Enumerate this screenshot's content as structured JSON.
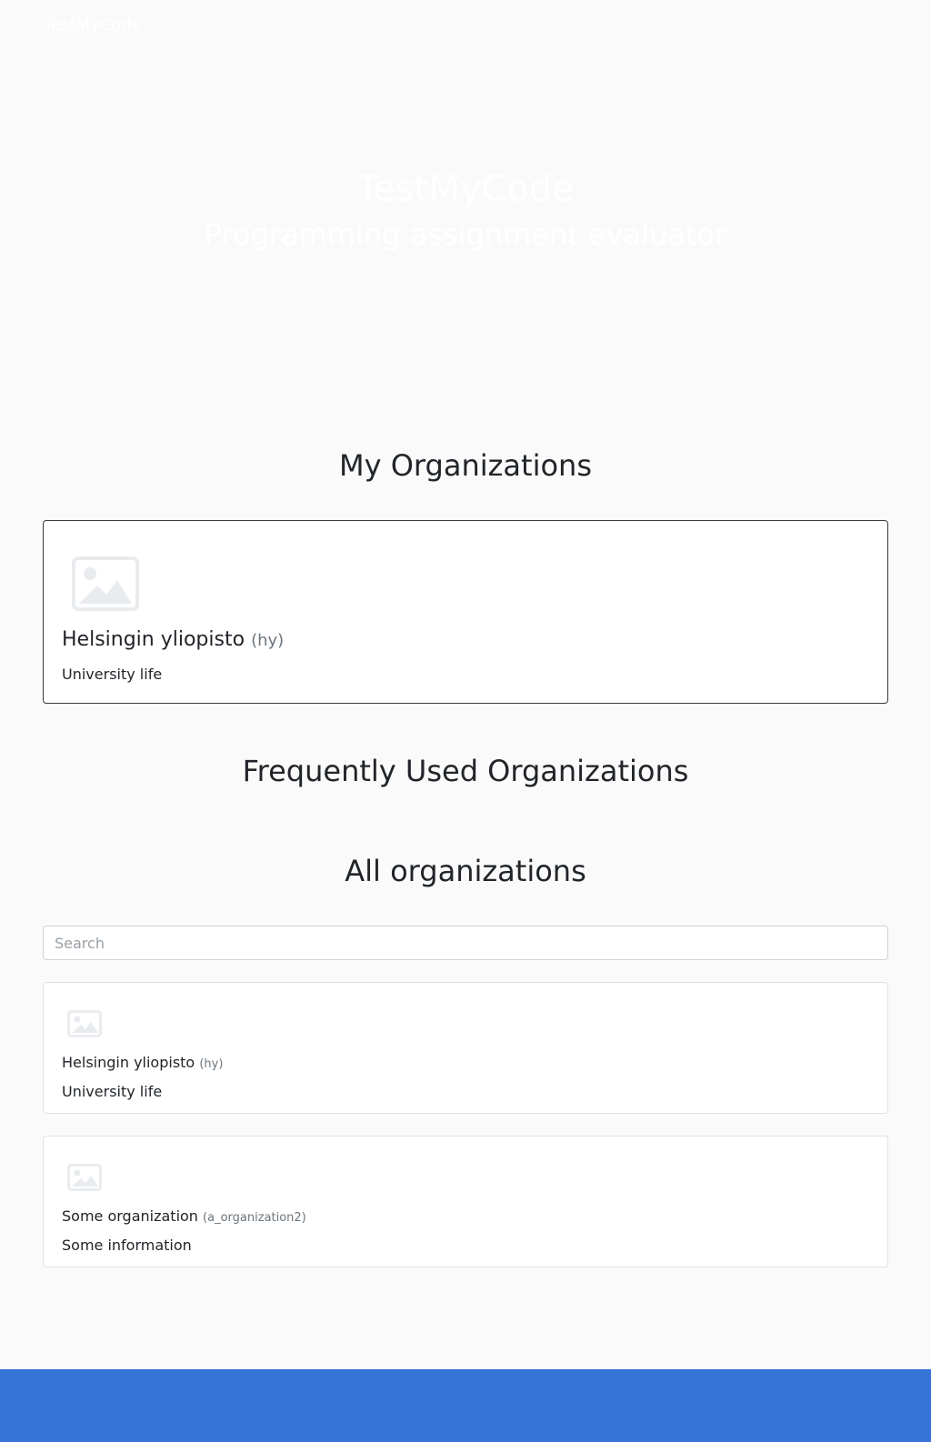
{
  "navbar": {
    "brand": "TestMyCode"
  },
  "hero": {
    "title": "TestMyCode",
    "subtitle": "Programming assignment evaluator"
  },
  "my_organizations": {
    "heading": "My Organizations",
    "items": [
      {
        "name": "Helsingin yliopisto",
        "slug": "(hy)",
        "description": "University life",
        "logo_icon": "image-placeholder-icon"
      }
    ]
  },
  "frequently_used": {
    "heading": "Frequently Used Organizations"
  },
  "all_organizations": {
    "heading": "All organizations",
    "search_placeholder": "Search",
    "items": [
      {
        "name": "Helsingin yliopisto",
        "slug": "(hy)",
        "description": "University life",
        "logo_icon": "image-placeholder-icon"
      },
      {
        "name": "Some organization",
        "slug": "(a_organization2)",
        "description": "Some information",
        "logo_icon": "image-placeholder-icon"
      }
    ]
  },
  "colors": {
    "page_background": "#fafafa",
    "footer_background": "#3674d8",
    "highlight_border": "#343a40",
    "placeholder_icon": "#e9ecef"
  }
}
